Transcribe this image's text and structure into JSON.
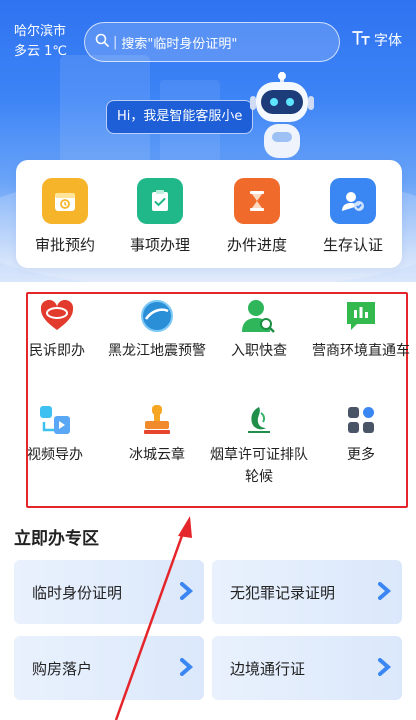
{
  "header": {
    "city": "哈尔滨市",
    "weather": "多云 1℃",
    "search_placeholder": "搜索\"临时身份证明\"",
    "font_label": "字体"
  },
  "assistant": {
    "greeting": "Hi，我是智能客服小e"
  },
  "services": [
    {
      "label": "审批预约",
      "icon": "calendar-icon",
      "color": "#f5b42a"
    },
    {
      "label": "事项办理",
      "icon": "clipboard-check-icon",
      "color": "#21b889"
    },
    {
      "label": "办件进度",
      "icon": "hourglass-icon",
      "color": "#f06a2b"
    },
    {
      "label": "生存认证",
      "icon": "user-verify-icon",
      "color": "#3a86f2"
    }
  ],
  "apps": [
    {
      "label": "民诉即办",
      "icon": "heart-logo-icon"
    },
    {
      "label": "黑龙江地震预警",
      "icon": "globe-logo-icon"
    },
    {
      "label": "入职快查",
      "icon": "person-search-icon"
    },
    {
      "label": "营商环境直通车",
      "icon": "chat-bars-icon"
    },
    {
      "label": "视频导办",
      "icon": "video-guide-icon"
    },
    {
      "label": "冰城云章",
      "icon": "stamp-icon"
    },
    {
      "label": "烟草许可证排队轮候",
      "icon": "tobacco-logo-icon"
    },
    {
      "label": "更多",
      "icon": "grid-more-icon"
    }
  ],
  "section": {
    "title": "立即办专区",
    "tiles": [
      "临时身份证明",
      "无犯罪记录证明",
      "购房落户",
      "边境通行证"
    ]
  },
  "colors": {
    "accent": "#2f73f0",
    "highlight": "#e4262b"
  }
}
